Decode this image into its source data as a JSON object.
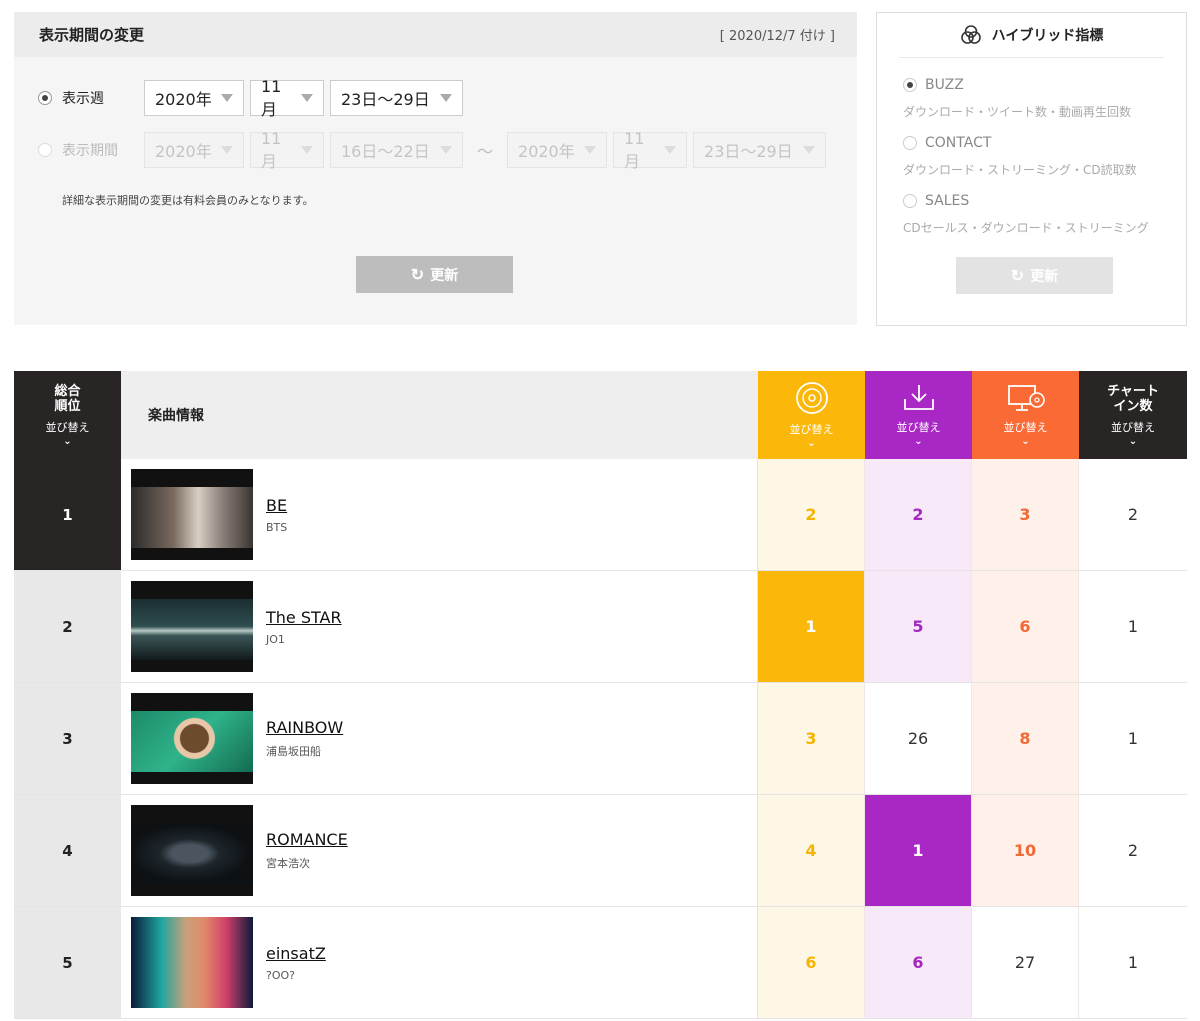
{
  "period": {
    "title": "表示期間の変更",
    "date": "[ 2020/12/7 付け ]",
    "week_label": "表示週",
    "range_label": "表示期間",
    "week": {
      "year": "2020年",
      "month": "11月",
      "days": "23日〜29日"
    },
    "range_from": {
      "year": "2020年",
      "month": "11月",
      "days": "16日〜22日"
    },
    "range_to": {
      "year": "2020年",
      "month": "11月",
      "days": "23日〜29日"
    },
    "tilde": "〜",
    "note": "詳細な表示期間の変更は有料会員のみとなります。",
    "update_label": "更新"
  },
  "hybrid": {
    "title": "ハイブリッド指標",
    "options": [
      {
        "name": "BUZZ",
        "desc": "ダウンロード・ツイート数・動画再生回数",
        "checked": true
      },
      {
        "name": "CONTACT",
        "desc": "ダウンロード・ストリーミング・CD読取数",
        "checked": false
      },
      {
        "name": "SALES",
        "desc": "CDセールス・ダウンロード・ストリーミング",
        "checked": false
      }
    ],
    "update_label": "更新"
  },
  "table": {
    "header": {
      "rank_line1": "総合",
      "rank_line2": "順位",
      "sort_label": "並び替え",
      "info_label": "楽曲情報",
      "chartin_line1": "チャート",
      "chartin_line2": "イン数"
    },
    "colors": {
      "cd": "#fbb80a",
      "download": "#a927c5",
      "streaming": "#fa6a35",
      "dark": "#2a2525"
    },
    "rows": [
      {
        "rank": "1",
        "title": "BE",
        "artist": "BTS",
        "cd": "2",
        "dl": "2",
        "st": "3",
        "chartin": "2"
      },
      {
        "rank": "2",
        "title": "The STAR",
        "artist": "JO1",
        "cd": "1",
        "dl": "5",
        "st": "6",
        "chartin": "1"
      },
      {
        "rank": "3",
        "title": "RAINBOW",
        "artist": "浦島坂田船",
        "cd": "3",
        "dl": "26",
        "st": "8",
        "chartin": "1"
      },
      {
        "rank": "4",
        "title": "ROMANCE",
        "artist": "宮本浩次",
        "cd": "4",
        "dl": "1",
        "st": "10",
        "chartin": "2"
      },
      {
        "rank": "5",
        "title": "einsatZ",
        "artist": "?OO?",
        "cd": "6",
        "dl": "6",
        "st": "27",
        "chartin": "1"
      }
    ]
  }
}
